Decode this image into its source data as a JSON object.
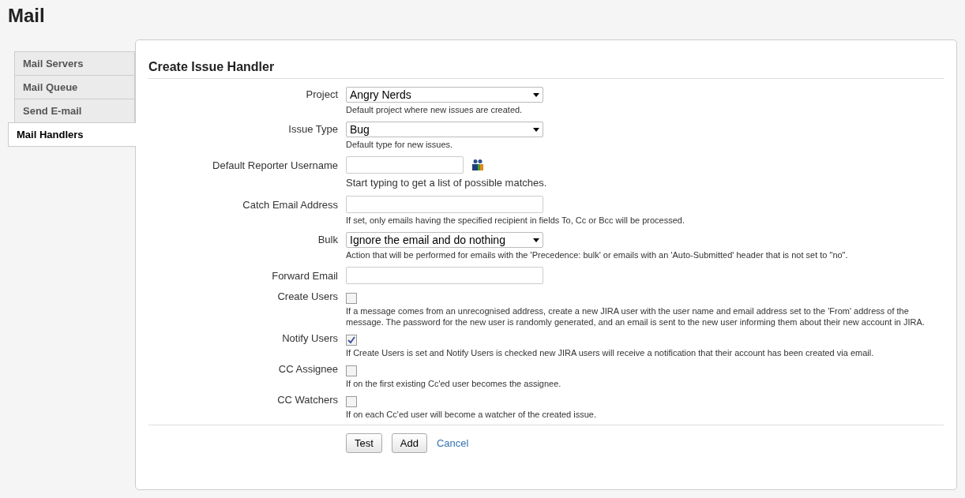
{
  "page_title": "Mail",
  "tabs": [
    {
      "label": "Mail Servers",
      "selected": false
    },
    {
      "label": "Mail Queue",
      "selected": false
    },
    {
      "label": "Send E-mail",
      "selected": false
    },
    {
      "label": "Mail Handlers",
      "selected": true
    }
  ],
  "form": {
    "title": "Create Issue Handler",
    "fields": [
      {
        "kind": "select",
        "label": "Project",
        "value": "Angry Nerds",
        "description": "Default project where new issues are created."
      },
      {
        "kind": "select",
        "label": "Issue Type",
        "value": "Bug",
        "description": "Default type for new issues."
      },
      {
        "kind": "user",
        "label": "Default Reporter Username",
        "description": "Start typing to get a list of possible matches."
      },
      {
        "kind": "text",
        "label": "Catch Email Address",
        "description": "If set, only emails having the specified recipient in fields To, Cc or Bcc will be processed."
      },
      {
        "kind": "select",
        "label": "Bulk",
        "value": "Ignore the email and do nothing",
        "description": "Action that will be performed for emails with the 'Precedence: bulk' or emails with an 'Auto-Submitted' header that is not set to \"no\"."
      },
      {
        "kind": "text",
        "label": "Forward Email"
      },
      {
        "kind": "checkbox",
        "label": "Create Users",
        "checked": false,
        "description": "If a message comes from an unrecognised address, create a new JIRA user with the user name and email address set to the 'From' address of the message. The password for the new user is randomly generated, and an email is sent to the new user informing them about their new account in JIRA."
      },
      {
        "kind": "checkbox",
        "label": "Notify Users",
        "checked": true,
        "description": "If Create Users is set and Notify Users is checked new JIRA users will receive a notification that their account has been created via email."
      },
      {
        "kind": "checkbox",
        "label": "CC Assignee",
        "checked": false,
        "description": "If on the first existing Cc'ed user becomes the assignee."
      },
      {
        "kind": "checkbox",
        "label": "CC Watchers",
        "checked": false,
        "description": "If on each Cc'ed user will become a watcher of the created issue."
      }
    ],
    "buttons": [
      "Test",
      "Add"
    ],
    "cancel_link": "Cancel"
  }
}
